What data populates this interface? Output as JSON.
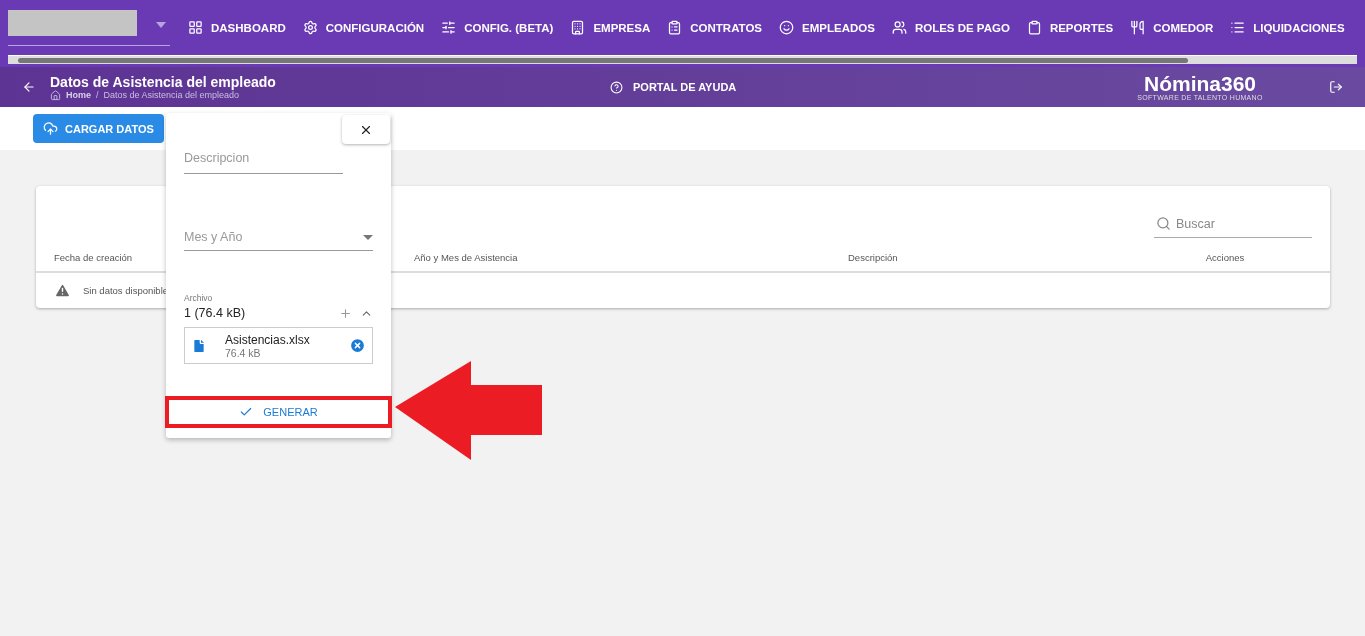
{
  "nav": {
    "items": [
      {
        "label": "DASHBOARD"
      },
      {
        "label": "CONFIGURACIÓN"
      },
      {
        "label": "CONFIG. (BETA)"
      },
      {
        "label": "EMPRESA"
      },
      {
        "label": "CONTRATOS"
      },
      {
        "label": "EMPLEADOS"
      },
      {
        "label": "ROLES DE PAGO"
      },
      {
        "label": "REPORTES"
      },
      {
        "label": "COMEDOR"
      },
      {
        "label": "LIQUIDACIONES"
      }
    ]
  },
  "header": {
    "title": "Datos de Asistencia del empleado",
    "breadcrumb": [
      "Home",
      "Datos de Asistencia del empleado"
    ],
    "breadcrumb_separator": "/",
    "help": "PORTAL DE AYUDA",
    "logo": "Nómina360",
    "logo_tagline": "SOFTWARE DE TALENTO HUMANO"
  },
  "toolbar": {
    "button": "CARGAR DATOS"
  },
  "table": {
    "search": {
      "placeholder": "Buscar"
    },
    "columns": [
      "Fecha de creación",
      "Año y Mes de Asistencia",
      "Descripción",
      "Acciones"
    ],
    "empty_message": "Sin datos disponible"
  },
  "upload_panel": {
    "description": {
      "placeholder": "Descripcion"
    },
    "month_year": {
      "placeholder": "Mes y Año"
    },
    "file_label": "Archivo",
    "file_summary": "1 (76.4 kB)",
    "files": [
      {
        "name": "Asistencias.xlsx",
        "size": "76.4 kB"
      }
    ],
    "submit": "GENERAR",
    "highlighted": true
  }
}
